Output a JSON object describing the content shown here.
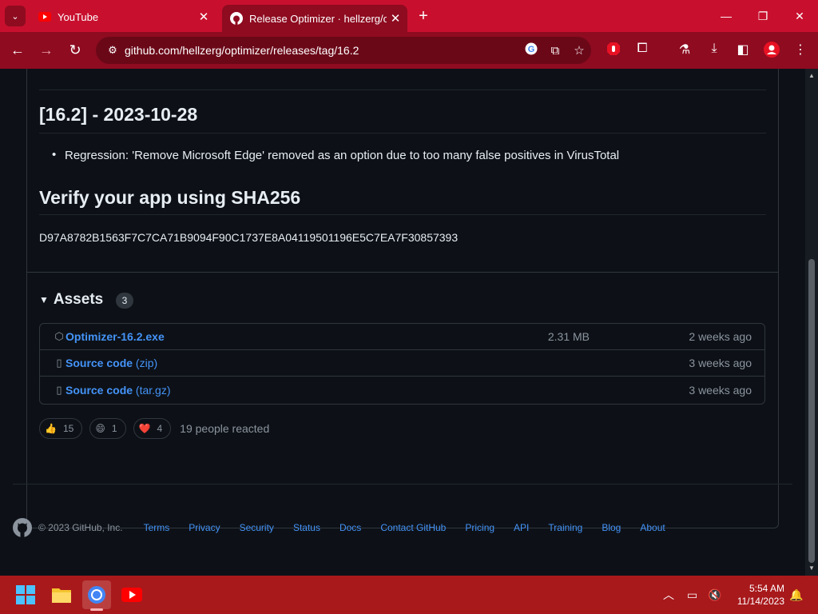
{
  "browser": {
    "tabs": [
      {
        "title": "YouTube",
        "active": false
      },
      {
        "title": "Release Optimizer · hellzerg/op",
        "active": true
      }
    ],
    "url": "github.com/hellzerg/optimizer/releases/tag/16.2"
  },
  "release": {
    "version_heading": "[16.2] - 2023-10-28",
    "changes": [
      "Regression: 'Remove Microsoft Edge' removed as an option due to too many false positives in VirusTotal"
    ],
    "verify_heading": "Verify your app using SHA256",
    "sha256": "D97A8782B1563F7C7CA71B9094F90C1737E8A04119501196E5C7EA7F30857393"
  },
  "assets": {
    "title": "Assets",
    "count": "3",
    "items": [
      {
        "name": "Optimizer-16.2.exe",
        "suffix": "",
        "size": "2.31 MB",
        "date": "2 weeks ago",
        "icon": "package-icon"
      },
      {
        "name": "Source code",
        "suffix": " (zip)",
        "size": "",
        "date": "3 weeks ago",
        "icon": "file-zip-icon"
      },
      {
        "name": "Source code",
        "suffix": " (tar.gz)",
        "size": "",
        "date": "3 weeks ago",
        "icon": "file-zip-icon"
      }
    ]
  },
  "reactions": {
    "items": [
      {
        "emoji": "👍",
        "count": "15"
      },
      {
        "emoji": "😄",
        "count": "1"
      },
      {
        "emoji": "❤️",
        "count": "4"
      }
    ],
    "summary": "19 people reacted"
  },
  "footer": {
    "copyright": "© 2023 GitHub, Inc.",
    "links": [
      "Terms",
      "Privacy",
      "Security",
      "Status",
      "Docs",
      "Contact GitHub",
      "Pricing",
      "API",
      "Training",
      "Blog",
      "About"
    ]
  },
  "taskbar": {
    "time": "5:54 AM",
    "date": "11/14/2023"
  },
  "colors": {
    "browser_accent": "#c8102e",
    "link": "#4493f8",
    "page_bg": "#0d1117",
    "taskbar": "#a8191c"
  }
}
